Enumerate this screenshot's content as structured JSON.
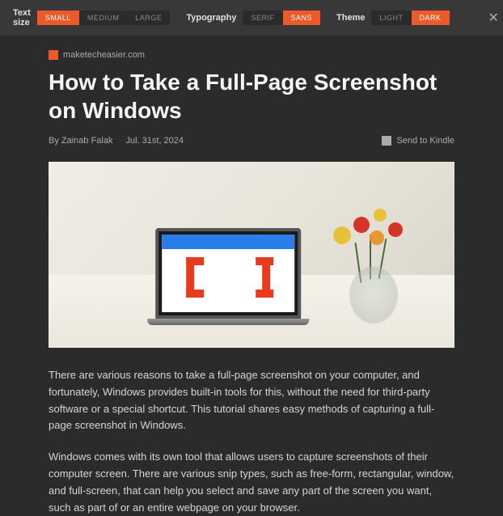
{
  "toolbar": {
    "text_size_label": "Text size",
    "text_size_options": {
      "small": "SMALL",
      "medium": "MEDIUM",
      "large": "LARGE"
    },
    "typography_label": "Typography",
    "typography_options": {
      "serif": "SERIF",
      "sans": "SANS"
    },
    "theme_label": "Theme",
    "theme_options": {
      "light": "LIGHT",
      "dark": "DARK"
    }
  },
  "article": {
    "source": "maketecheasier.com",
    "title": "How to Take a Full-Page Screenshot on Windows",
    "author": "By Zainab Falak",
    "date": "Jul. 31st, 2024",
    "send_kindle": "Send to Kindle",
    "paragraphs": [
      "There are various reasons to take a full-page screenshot on your computer, and fortunately, Windows provides built-in tools for this, without the need for third-party software or a special shortcut. This tutorial shares easy methods of capturing a full-page screenshot in Windows.",
      "Windows comes with its own tool that allows users to capture screenshots of their computer screen. There are various snip types, such as free-form, rectangular, window, and full-screen, that can help you select and save any part of the screen you want, such as part of or an entire webpage on your browser."
    ]
  }
}
